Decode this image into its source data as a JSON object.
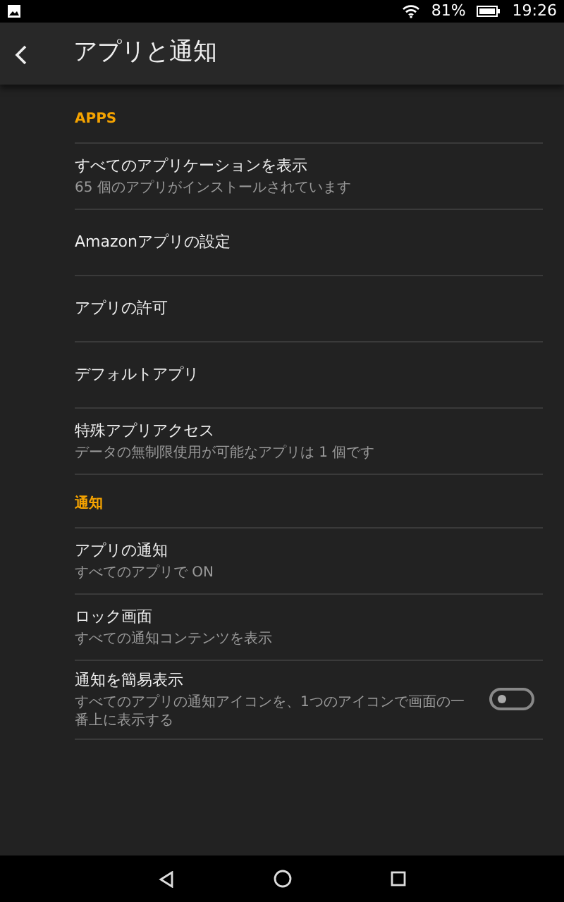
{
  "status_bar": {
    "battery": "81%",
    "time": "19:26"
  },
  "header": {
    "title": "アプリと通知"
  },
  "sections": [
    {
      "title": "APPS",
      "items": [
        {
          "kind": "text",
          "title": "すべてのアプリケーションを表示",
          "subtitle": "65 個のアプリがインストールされています"
        },
        {
          "kind": "text",
          "title": "Amazonアプリの設定"
        },
        {
          "kind": "text",
          "title": "アプリの許可"
        },
        {
          "kind": "text",
          "title": "デフォルトアプリ"
        },
        {
          "kind": "text",
          "title": "特殊アプリアクセス",
          "subtitle": "データの無制限使用が可能なアプリは 1 個です"
        }
      ]
    },
    {
      "title": "通知",
      "items": [
        {
          "kind": "text",
          "title": "アプリの通知",
          "subtitle": "すべてのアプリで ON"
        },
        {
          "kind": "text",
          "title": "ロック画面",
          "subtitle": "すべての通知コンテンツを表示"
        },
        {
          "kind": "toggle",
          "title": "通知を簡易表示",
          "subtitle": "すべてのアプリの通知アイコンを、1つのアイコンで画面の一番上に表示する",
          "on": false
        }
      ]
    }
  ]
}
